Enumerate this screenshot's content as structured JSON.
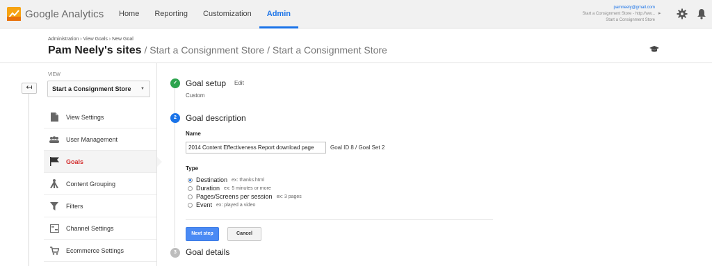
{
  "topbar": {
    "logo_text": "Google Analytics",
    "nav": [
      "Home",
      "Reporting",
      "Customization",
      "Admin"
    ],
    "active_nav": "Admin",
    "account_email": "pamneely@gmail.com",
    "account_line1": "Start a Consignment Store - http://ww...",
    "account_line2": "Start a Consignment Store",
    "icons": [
      "settings-gear-icon",
      "notifications-bell-icon"
    ]
  },
  "header": {
    "breadcrumb": "Administration › View Goals › New Goal",
    "title_main": "Pam Neely's sites",
    "title_rest": " / Start a Consignment Store / Start a Consignment Store"
  },
  "sidebar": {
    "back_label": "↤",
    "view_label": "VIEW",
    "view_selected": "Start a Consignment Store",
    "items": [
      {
        "label": "View Settings",
        "icon": "document-icon"
      },
      {
        "label": "User Management",
        "icon": "users-icon"
      },
      {
        "label": "Goals",
        "icon": "flag-icon",
        "active": true
      },
      {
        "label": "Content Grouping",
        "icon": "grouping-icon"
      },
      {
        "label": "Filters",
        "icon": "filter-icon"
      },
      {
        "label": "Channel Settings",
        "icon": "channel-icon"
      },
      {
        "label": "Ecommerce Settings",
        "icon": "cart-icon"
      }
    ]
  },
  "goal": {
    "setup": {
      "number": "✓",
      "title": "Goal setup",
      "edit": "Edit",
      "value": "Custom"
    },
    "description": {
      "number": "2",
      "title": "Goal description",
      "name_label": "Name",
      "name_value": "2014 Content Effectiveness Report download page",
      "goal_id": "Goal ID 8 / Goal Set 2",
      "type_label": "Type",
      "types": [
        {
          "label": "Destination",
          "example": "ex: thanks.html",
          "selected": true
        },
        {
          "label": "Duration",
          "example": "ex: 5 minutes or more",
          "selected": false
        },
        {
          "label": "Pages/Screens per session",
          "example": "ex: 3 pages",
          "selected": false
        },
        {
          "label": "Event",
          "example": "ex: played a video",
          "selected": false
        }
      ],
      "next_button": "Next step",
      "cancel_button": "Cancel"
    },
    "details": {
      "number": "3",
      "title": "Goal details"
    }
  }
}
